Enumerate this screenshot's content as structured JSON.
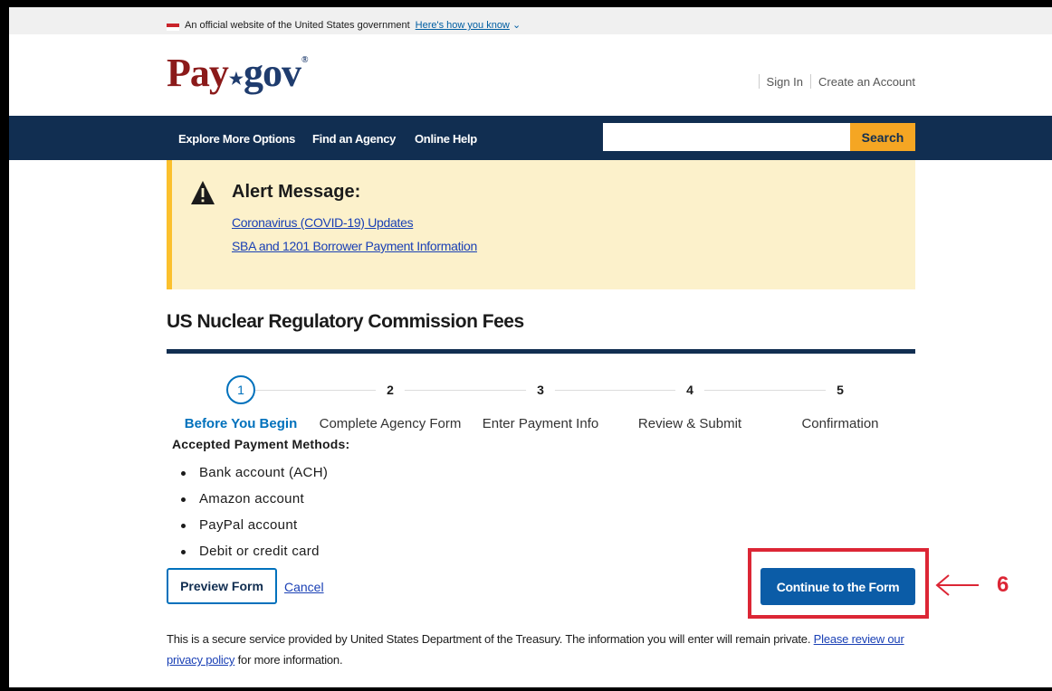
{
  "gov_banner": {
    "text": "An official website of the United States government",
    "link": "Here's how you know"
  },
  "logo": {
    "pay": "Pay",
    "gov": "gov",
    "reg": "®"
  },
  "account": {
    "sign_in": "Sign In",
    "create": "Create an Account"
  },
  "nav": {
    "items": [
      "Explore More Options",
      "Find an Agency",
      "Online Help"
    ],
    "search_button": "Search",
    "search_value": ""
  },
  "alert": {
    "title": "Alert Message:",
    "links": [
      "Coronavirus (COVID-19) Updates",
      "SBA and 1201 Borrower Payment Information"
    ]
  },
  "page_title": "US Nuclear Regulatory Commission Fees",
  "steps": [
    {
      "num": "1",
      "label": "Before You Begin",
      "active": true
    },
    {
      "num": "2",
      "label": "Complete Agency Form",
      "active": false
    },
    {
      "num": "3",
      "label": "Enter Payment Info",
      "active": false
    },
    {
      "num": "4",
      "label": "Review & Submit",
      "active": false
    },
    {
      "num": "5",
      "label": "Confirmation",
      "active": false
    }
  ],
  "payment_methods": {
    "title": "Accepted Payment Methods:",
    "items": [
      "Bank account (ACH)",
      "Amazon account",
      "PayPal account",
      "Debit or credit card"
    ]
  },
  "actions": {
    "preview": "Preview Form",
    "cancel": "Cancel",
    "continue": "Continue to the Form"
  },
  "callout": {
    "number": "6",
    "color": "#dc2635"
  },
  "footer": {
    "text": "This is a secure service provided by United States Department of the Treasury. The information you will enter will remain private. ",
    "link": "Please review our privacy policy",
    "suffix": " for more information."
  },
  "colors": {
    "navbar": "#112e51",
    "search": "#f5a623",
    "alert_bg": "#fcf1cb",
    "alert_border": "#fbc02d",
    "primary": "#0b5ca7",
    "link": "#1a40b5"
  }
}
